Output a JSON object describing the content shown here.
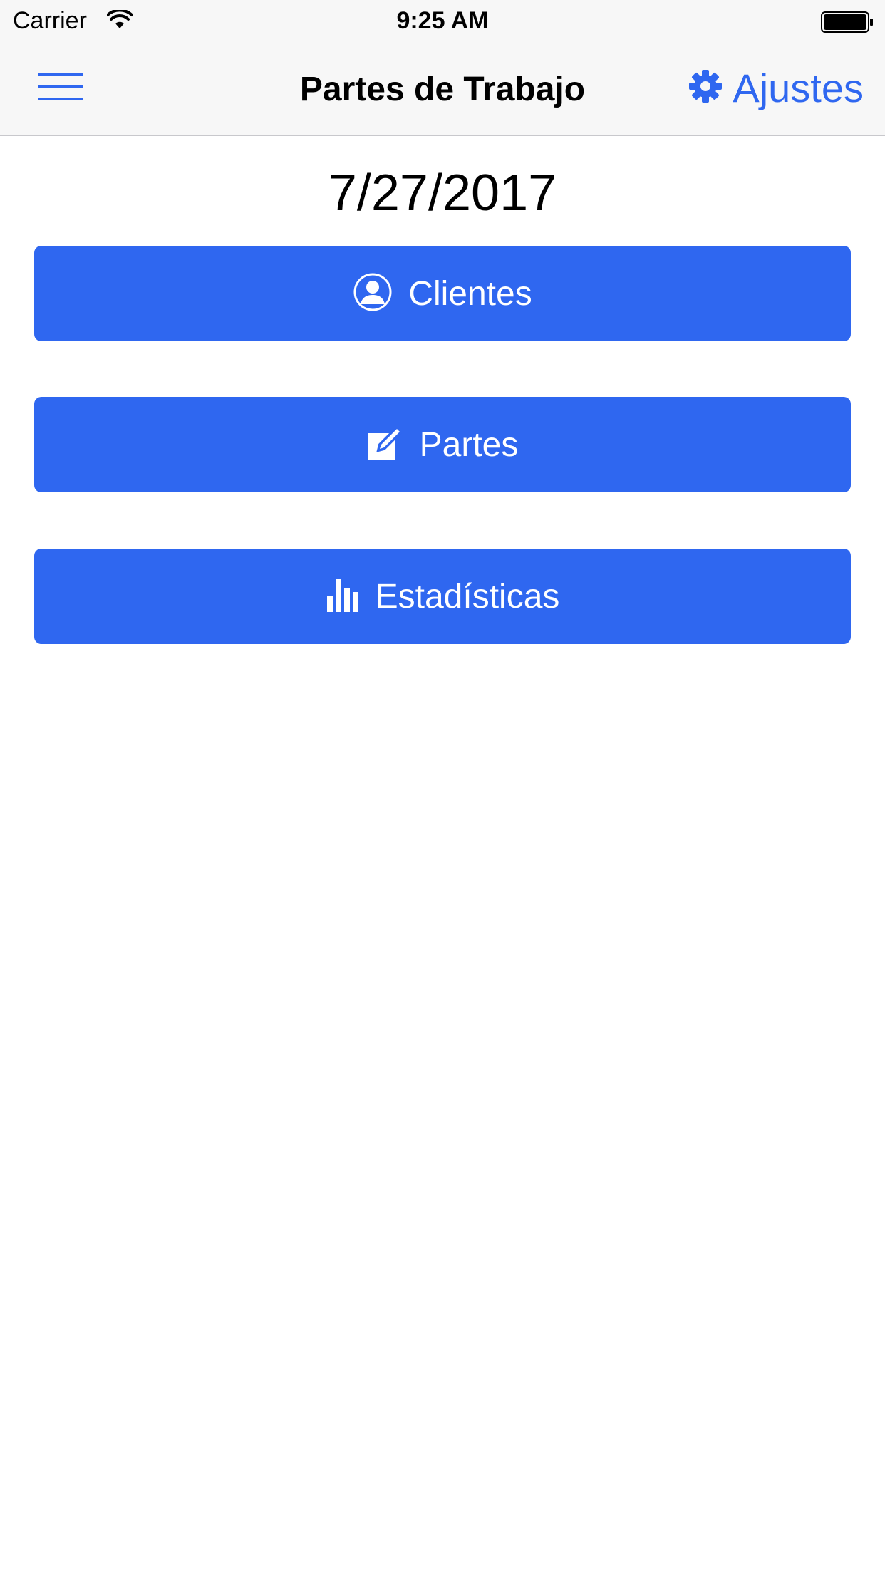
{
  "status_bar": {
    "carrier": "Carrier",
    "time": "9:25 AM",
    "wifi_icon": "wifi-icon",
    "battery_icon": "battery-icon"
  },
  "nav_bar": {
    "title": "Partes de Trabajo",
    "menu_icon": "hamburger-menu-icon",
    "settings_icon": "gear-icon",
    "settings_label": "Ajustes"
  },
  "date": "7/27/2017",
  "buttons": [
    {
      "label": "Clientes",
      "icon": "user-circle-icon"
    },
    {
      "label": "Partes",
      "icon": "edit-icon"
    },
    {
      "label": "Estadísticas",
      "icon": "bar-chart-icon"
    }
  ],
  "colors": {
    "accent": "#2f67f0",
    "bar_background": "#f7f7f7",
    "button_text": "#ffffff"
  }
}
